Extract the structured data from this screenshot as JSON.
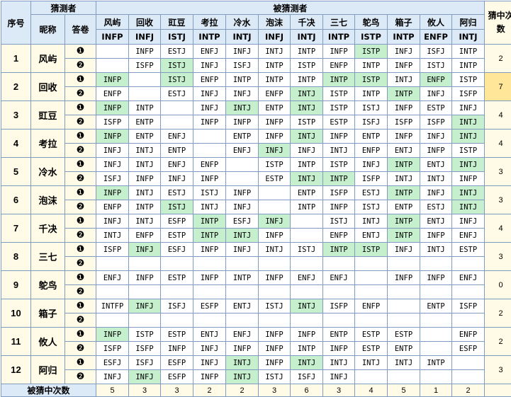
{
  "header": {
    "seq": "序号",
    "guesser": "猜测者",
    "guessed": "被猜测者",
    "nick": "昵称",
    "sheet": "答卷",
    "hits": "猜中次数"
  },
  "sheet_marks": [
    "❶",
    "❷"
  ],
  "players": [
    {
      "name": "风屿",
      "type": "INFP"
    },
    {
      "name": "回收",
      "type": "INFJ"
    },
    {
      "name": "豇豆",
      "type": "ISTJ"
    },
    {
      "name": "考拉",
      "type": "INTP"
    },
    {
      "name": "冷水",
      "type": "INTJ"
    },
    {
      "name": "泡沫",
      "type": "INFJ"
    },
    {
      "name": "千决",
      "type": "INTJ"
    },
    {
      "name": "三七",
      "type": "INTP"
    },
    {
      "name": "鸵鸟",
      "type": "ISTP"
    },
    {
      "name": "箱子",
      "type": "INTP"
    },
    {
      "name": "攸人",
      "type": "ENFP"
    },
    {
      "name": "阿归",
      "type": "INTJ"
    }
  ],
  "rows": [
    {
      "seq": "1",
      "hits": "2",
      "highlight": false,
      "sheets": [
        [
          "",
          "INFP",
          "ESTJ",
          "ENFJ",
          "INFJ",
          "INTJ",
          "INTP",
          "INFP",
          "ISTP",
          "INFJ",
          "ISFJ",
          "INTP"
        ],
        [
          "",
          "ISFP",
          "ISTJ",
          "INFJ",
          "ISFJ",
          "INTP",
          "ISTP",
          "ENFP",
          "INTP",
          "INFP",
          "ISTJ",
          "INTP"
        ]
      ]
    },
    {
      "seq": "2",
      "hits": "7",
      "highlight": true,
      "sheets": [
        [
          "INFP",
          "",
          "ISTJ",
          "ENFP",
          "INTP",
          "INTP",
          "INTP",
          "INTP",
          "ISTP",
          "INTJ",
          "ENFP",
          "ISTP"
        ],
        [
          "ENFP",
          "",
          "ESTJ",
          "INFJ",
          "INFJ",
          "ENFP",
          "INTJ",
          "ISTP",
          "INTP",
          "INTP",
          "INFJ",
          "ISFP"
        ]
      ]
    },
    {
      "seq": "3",
      "hits": "4",
      "highlight": false,
      "sheets": [
        [
          "INFP",
          "INTP",
          "",
          "INFJ",
          "INTJ",
          "ENTP",
          "INTJ",
          "ISTP",
          "ISTJ",
          "INFP",
          "ESTP",
          "INFJ"
        ],
        [
          "ISFP",
          "ENTP",
          "",
          "INFP",
          "INFP",
          "INFP",
          "ISTP",
          "ESTP",
          "ISFJ",
          "ISFP",
          "ISFP",
          "INTJ"
        ]
      ]
    },
    {
      "seq": "4",
      "hits": "4",
      "highlight": false,
      "sheets": [
        [
          "INFP",
          "ENTP",
          "ENFJ",
          "",
          "ENTP",
          "INFP",
          "INTJ",
          "INFP",
          "ENTP",
          "INFP",
          "INFJ",
          "INTJ"
        ],
        [
          "INFJ",
          "INTJ",
          "ENTP",
          "",
          "ENFJ",
          "INFJ",
          "INFJ",
          "INTJ",
          "ENFP",
          "ENTJ",
          "INFP",
          "ISTP"
        ]
      ]
    },
    {
      "seq": "5",
      "hits": "3",
      "highlight": false,
      "sheets": [
        [
          "INFJ",
          "INTJ",
          "ENFJ",
          "ENFP",
          "",
          "ISTP",
          "INTP",
          "ISTP",
          "INFJ",
          "INTP",
          "ENTJ",
          "INTJ"
        ],
        [
          "ISFJ",
          "INFP",
          "INFJ",
          "INFP",
          "",
          "ESTP",
          "INTJ",
          "INTP",
          "ISFP",
          "INTJ",
          "INTJ",
          "INFP"
        ]
      ]
    },
    {
      "seq": "6",
      "hits": "3",
      "highlight": false,
      "sheets": [
        [
          "INFP",
          "INTJ",
          "ESTJ",
          "ISTJ",
          "INFP",
          "",
          "ENTP",
          "ISFP",
          "ESTJ",
          "INTP",
          "INFJ",
          "INTJ"
        ],
        [
          "ENFP",
          "INTP",
          "ISTJ",
          "INTJ",
          "INFJ",
          "",
          "INTP",
          "INFP",
          "ISTJ",
          "ENTP",
          "ESTJ",
          "INTJ"
        ]
      ]
    },
    {
      "seq": "7",
      "hits": "4",
      "highlight": false,
      "sheets": [
        [
          "INFJ",
          "INTJ",
          "ESFP",
          "INTP",
          "ESFJ",
          "INFJ",
          "",
          "ISTJ",
          "INTJ",
          "INTP",
          "ENTJ",
          "INFJ"
        ],
        [
          "INTJ",
          "ENFP",
          "ESTP",
          "INTP",
          "INTJ",
          "INFP",
          "",
          "ENFP",
          "ENTJ",
          "INTP",
          "INFP",
          "ENFJ"
        ]
      ]
    },
    {
      "seq": "8",
      "hits": "3",
      "highlight": false,
      "sheets": [
        [
          "ISFP",
          "INFJ",
          "ESFJ",
          "INFP",
          "INFJ",
          "INTJ",
          "ISTJ",
          "INTP",
          "ISTP",
          "INFJ",
          "INTJ",
          "ESTP"
        ],
        [
          "",
          "",
          "",
          "",
          "",
          "",
          "",
          "",
          "",
          "",
          "",
          ""
        ]
      ]
    },
    {
      "seq": "9",
      "hits": "0",
      "highlight": false,
      "sheets": [
        [
          "ENFJ",
          "INFP",
          "ESTP",
          "INFP",
          "INTP",
          "INFP",
          "ENFJ",
          "ENFJ",
          "",
          "INFP",
          "INFP",
          "ENFJ"
        ],
        [
          "",
          "",
          "",
          "",
          "",
          "",
          "",
          "",
          "",
          "",
          "",
          ""
        ]
      ]
    },
    {
      "seq": "10",
      "hits": "2",
      "highlight": false,
      "sheets": [
        [
          "INTFP",
          "INFJ",
          "ISFJ",
          "ESFP",
          "ENTJ",
          "ISTJ",
          "INTJ",
          "ISFP",
          "ENFP",
          "",
          "ENTP",
          "ISFP"
        ],
        [
          "",
          "",
          "",
          "",
          "",
          "",
          "",
          "",
          "",
          "",
          "",
          ""
        ]
      ]
    },
    {
      "seq": "11",
      "hits": "2",
      "highlight": false,
      "sheets": [
        [
          "INFP",
          "ISTP",
          "ESTP",
          "ENTJ",
          "ENFJ",
          "INFP",
          "INFP",
          "ENTP",
          "ESTP",
          "ESTP",
          "",
          "ENFP"
        ],
        [
          "ISFP",
          "ISFP",
          "INFP",
          "INFJ",
          "INFP",
          "INFP",
          "INTP",
          "INFP",
          "ESTP",
          "ENTP",
          "",
          "ESFP"
        ]
      ]
    },
    {
      "seq": "12",
      "hits": "3",
      "highlight": false,
      "sheets": [
        [
          "ESFJ",
          "ISFJ",
          "ESFP",
          "INFJ",
          "INTJ",
          "INFP",
          "INTJ",
          "INTJ",
          "INTJ",
          "INTJ",
          "INTP",
          ""
        ],
        [
          "INFJ",
          "INFJ",
          "ESFP",
          "INFP",
          "INTJ",
          "ISTJ",
          "ISFJ",
          "INFJ",
          "",
          "",
          "",
          ""
        ]
      ]
    }
  ],
  "footer": {
    "label": "被猜中次数",
    "values": [
      "5",
      "3",
      "3",
      "2",
      "2",
      "3",
      "6",
      "3",
      "4",
      "5",
      "1",
      "2"
    ]
  },
  "colors": {
    "header_bg": "#dce9f7",
    "side_bg": "#fffbe6",
    "hit_bg": "#c6efce",
    "highlight_bg": "#ffe699",
    "border": "#7f9bbf"
  }
}
